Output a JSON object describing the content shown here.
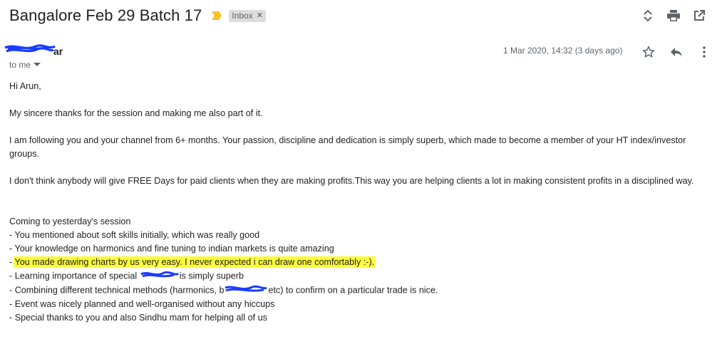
{
  "email": {
    "subject": "Bangalore Feb 29 Batch 17",
    "label": "Inbox",
    "sender_visible": "ar",
    "recipient": "to me",
    "date": "1 Mar 2020, 14:32 (3 days ago)",
    "body": {
      "greeting": "Hi Arun,",
      "p1": "My sincere thanks for the session and making me also part of it.",
      "p2": "I am following you and your channel from 6+ months. Your passion, discipline and dedication is simply superb, which made to become a member of your HT index/investor groups.",
      "p3": "I don't think anybody will give FREE Days for paid clients when they are making profits.This way you are helping clients a lot in making consistent profits in a disciplined way.",
      "session_heading": "Coming to yesterday's session",
      "bullets": {
        "b1": "- You mentioned about soft skills initially, which was really good",
        "b2": "- Your knowledge on harmonics and fine tuning to indian markets is quite amazing",
        "b3_prefix": "- ",
        "b3_highlight": "You made drawing charts by us very easy. I never expected i can draw one comfortably :-).",
        "b4_pre": "- Learning importance of special ",
        "b4_post": "is simply superb",
        "b5_pre": "- Combining different technical methods (harmonics, b",
        "b5_post": "etc) to confirm on a particular trade is nice.",
        "b6": "- Event was nicely planned and well-organised without any hiccups",
        "b7": "- Special thanks to you and also Sindhu mam for helping all of us"
      }
    }
  },
  "icons": {
    "importance": "importance-marker-icon",
    "label_close": "close-icon",
    "expand": "expand-collapse-icon",
    "print": "print-icon",
    "popout": "open-in-new-window-icon",
    "star": "star-icon",
    "reply": "reply-icon",
    "more": "more-vert-icon",
    "dropdown": "arrow-drop-down-icon"
  },
  "colors": {
    "highlight": "#fcfc3a",
    "redaction": "#1a3cff",
    "importance": "#f6c026"
  }
}
